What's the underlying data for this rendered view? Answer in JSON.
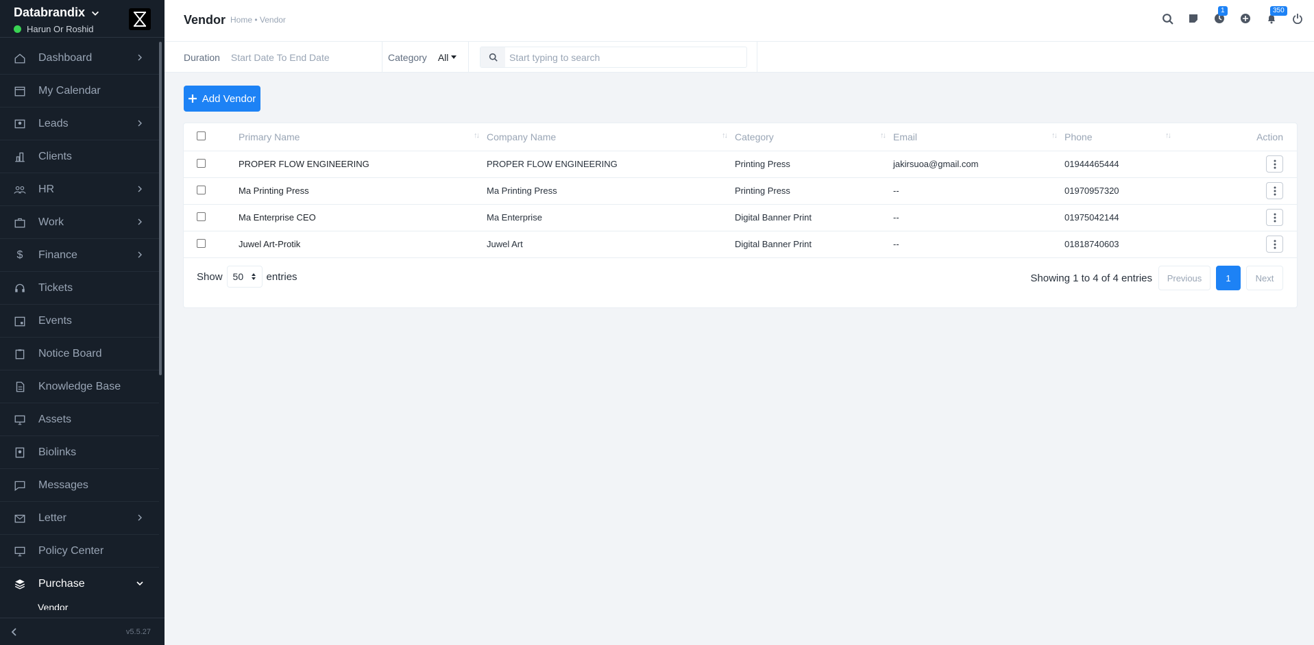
{
  "sidebar": {
    "company": "Databrandix",
    "user": "Harun Or Roshid",
    "version": "v5.5.27",
    "items": [
      {
        "label": "Dashboard",
        "icon": "home-icon",
        "has_arrow": true
      },
      {
        "label": "My Calendar",
        "icon": "calendar-icon",
        "has_arrow": false
      },
      {
        "label": "Leads",
        "icon": "person-card-icon",
        "has_arrow": true
      },
      {
        "label": "Clients",
        "icon": "building-icon",
        "has_arrow": false
      },
      {
        "label": "HR",
        "icon": "people-icon",
        "has_arrow": true
      },
      {
        "label": "Work",
        "icon": "briefcase-icon",
        "has_arrow": true
      },
      {
        "label": "Finance",
        "icon": "dollar-icon",
        "has_arrow": true
      },
      {
        "label": "Tickets",
        "icon": "headset-icon",
        "has_arrow": false
      },
      {
        "label": "Events",
        "icon": "calendar-event-icon",
        "has_arrow": false
      },
      {
        "label": "Notice Board",
        "icon": "clipboard-icon",
        "has_arrow": false
      },
      {
        "label": "Knowledge Base",
        "icon": "document-icon",
        "has_arrow": false
      },
      {
        "label": "Assets",
        "icon": "monitor-icon",
        "has_arrow": false
      },
      {
        "label": "Biolinks",
        "icon": "badge-icon",
        "has_arrow": false
      },
      {
        "label": "Messages",
        "icon": "chat-icon",
        "has_arrow": false
      },
      {
        "label": "Letter",
        "icon": "envelope-icon",
        "has_arrow": true
      },
      {
        "label": "Policy Center",
        "icon": "monitor-icon",
        "has_arrow": false
      },
      {
        "label": "Purchase",
        "icon": "layers-icon",
        "has_arrow": true,
        "expanded": true
      }
    ],
    "sub_item": "Vendor"
  },
  "header": {
    "title": "Vendor",
    "breadcrumb": "Home • Vendor",
    "badges": {
      "clock": "1",
      "bell": "350"
    }
  },
  "filters": {
    "duration_label": "Duration",
    "duration_value": "Start Date To End Date",
    "category_label": "Category",
    "category_value": "All",
    "search_placeholder": "Start typing to search"
  },
  "add_button": "Add Vendor",
  "table": {
    "columns": [
      "Primary Name",
      "Company Name",
      "Category",
      "Email",
      "Phone",
      "Action"
    ],
    "rows": [
      {
        "primary": "PROPER FLOW ENGINEERING",
        "company": "PROPER FLOW ENGINEERING",
        "category": "Printing Press",
        "email": "jakirsuoa@gmail.com",
        "phone": "01944465444"
      },
      {
        "primary": "Ma Printing Press",
        "company": "Ma Printing Press",
        "category": "Printing Press",
        "email": "--",
        "phone": "01970957320"
      },
      {
        "primary": "Ma Enterprise CEO",
        "company": "Ma Enterprise",
        "category": "Digital Banner Print",
        "email": "--",
        "phone": "01975042144"
      },
      {
        "primary": "Juwel Art-Protik",
        "company": "Juwel Art",
        "category": "Digital Banner Print",
        "email": "--",
        "phone": "01818740603"
      }
    ]
  },
  "footer": {
    "show_label": "Show",
    "entries_value": "50",
    "entries_label": "entries",
    "showing_text": "Showing 1 to 4 of 4 entries",
    "prev": "Previous",
    "current_page": "1",
    "next": "Next"
  },
  "colors": {
    "accent": "#1d82f5",
    "sidebar_bg": "#171f29",
    "page_bg": "#f2f4f7"
  }
}
